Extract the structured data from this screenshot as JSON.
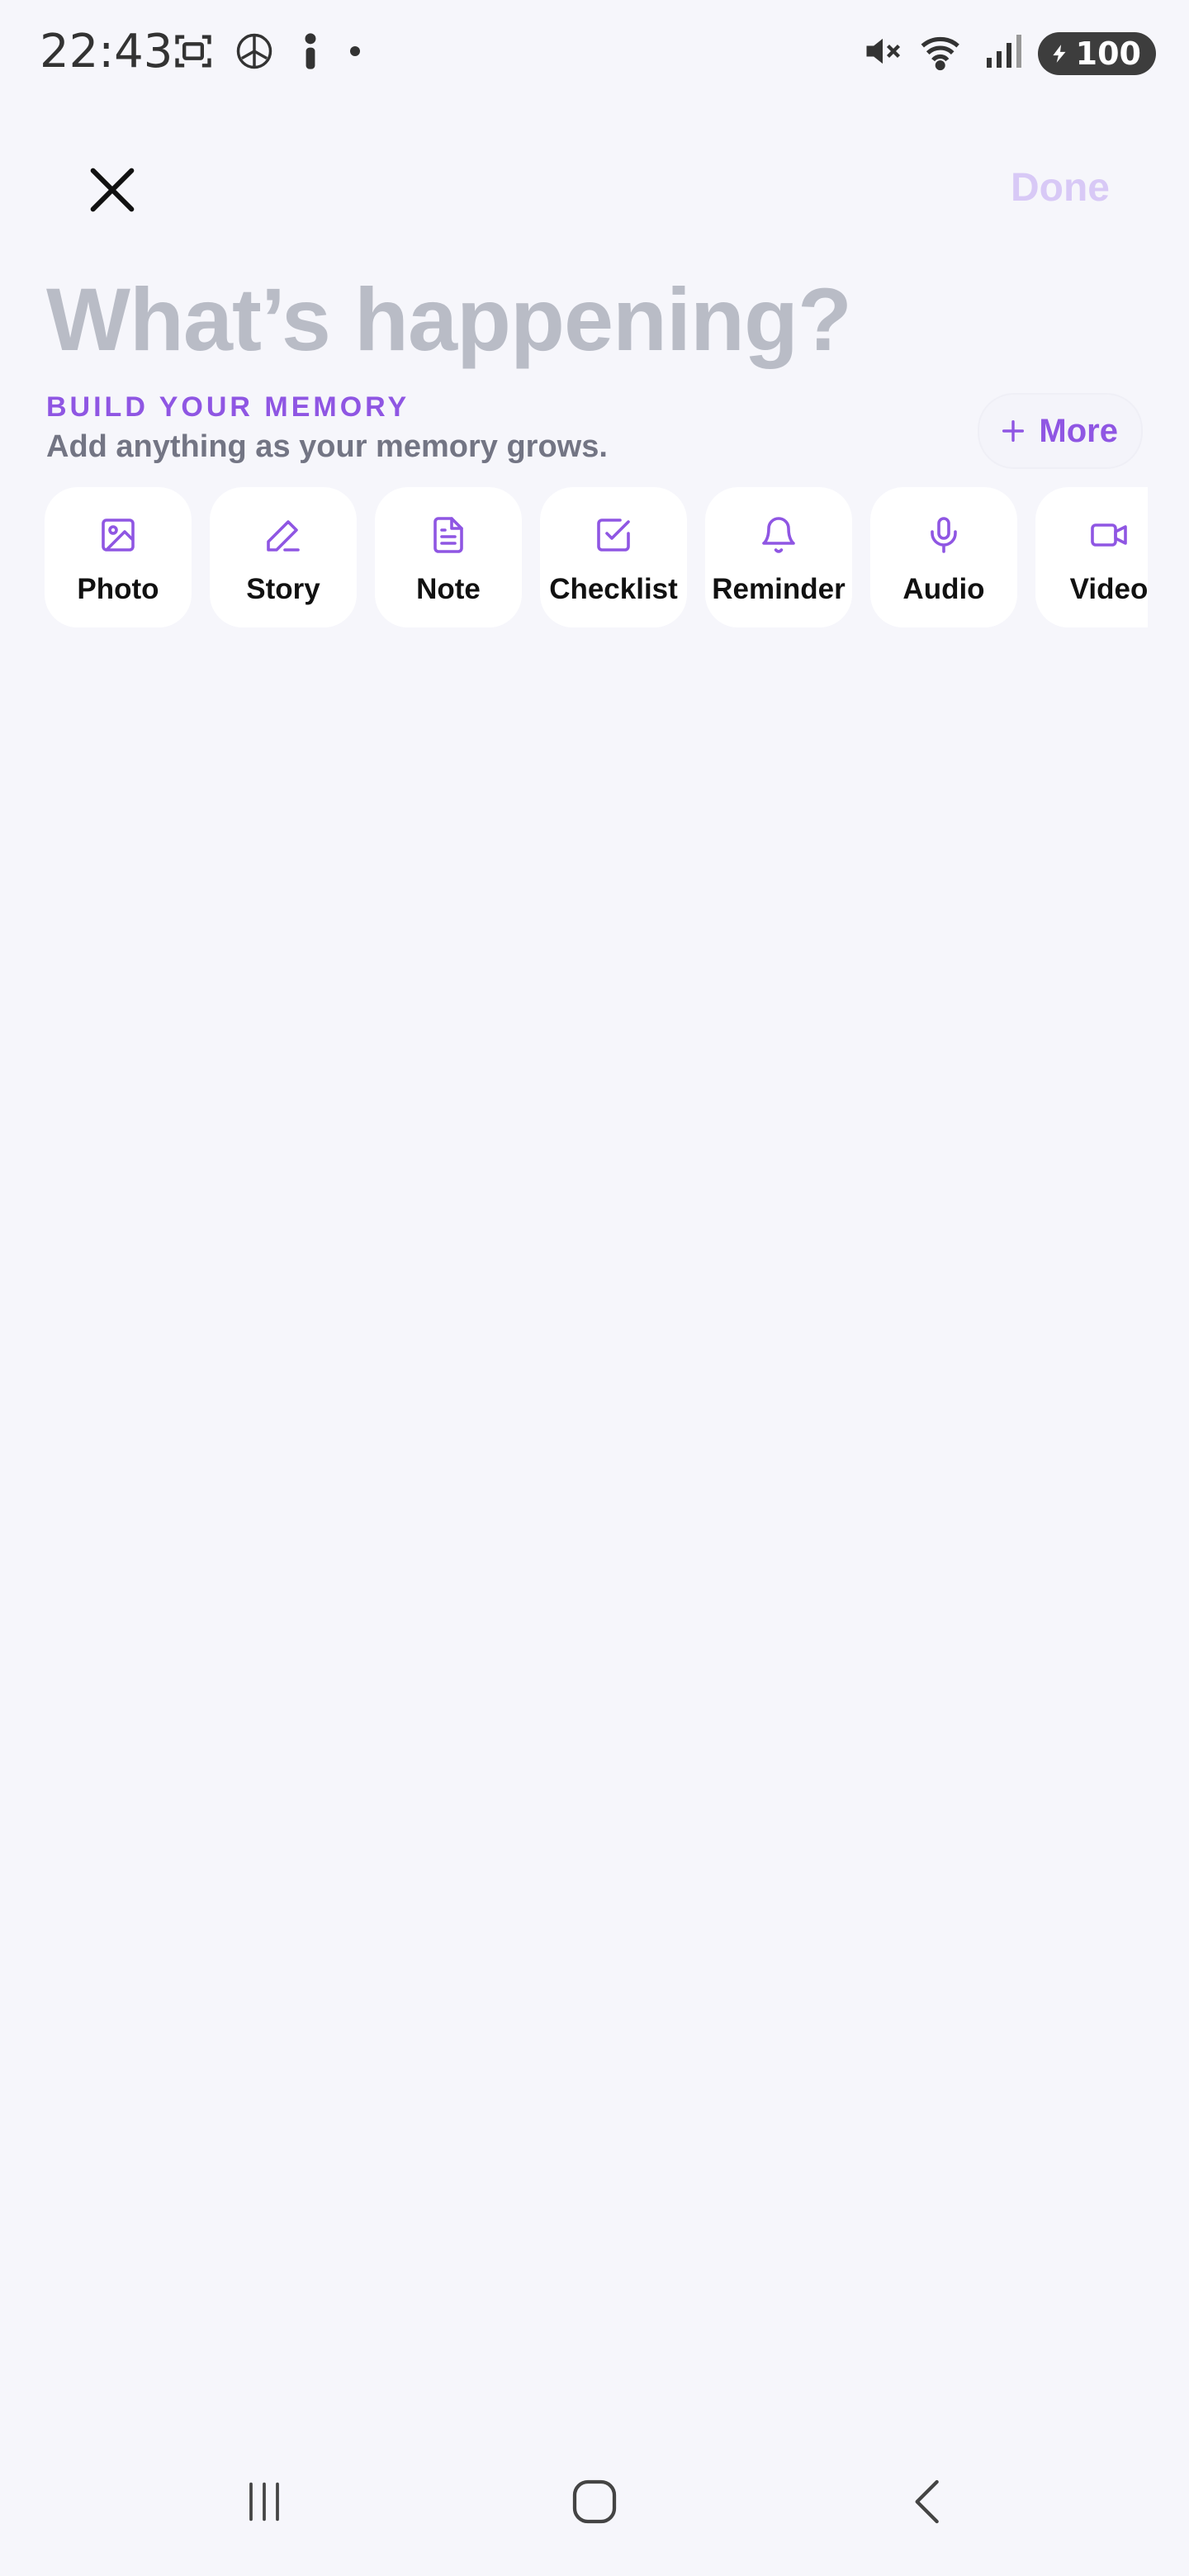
{
  "status_bar": {
    "time": "22:43",
    "battery": "100",
    "left_icons": [
      "screenshot-icon",
      "chatgpt-icon",
      "info-icon",
      "dot-icon"
    ],
    "right_icons": [
      "mute-icon",
      "wifi-icon",
      "signal-icon",
      "battery-icon"
    ]
  },
  "header": {
    "close_icon": "close-icon",
    "done_label": "Done"
  },
  "composer": {
    "placeholder_title": "What’s happening?"
  },
  "memory": {
    "label": "BUILD YOUR MEMORY",
    "subtitle": "Add anything as your memory grows.",
    "more_label": "More"
  },
  "actions": [
    {
      "label": "Photo",
      "icon": "image-icon"
    },
    {
      "label": "Story",
      "icon": "pencil-icon"
    },
    {
      "label": "Note",
      "icon": "document-icon"
    },
    {
      "label": "Checklist",
      "icon": "checkbox-icon"
    },
    {
      "label": "Reminder",
      "icon": "bell-icon"
    },
    {
      "label": "Audio",
      "icon": "microphone-icon"
    },
    {
      "label": "Video",
      "icon": "video-icon"
    }
  ],
  "colors": {
    "accent": "#8f56e3",
    "done_disabled": "#d8c9f6",
    "placeholder": "#b9bcc6",
    "background": "#f6f6fb"
  }
}
